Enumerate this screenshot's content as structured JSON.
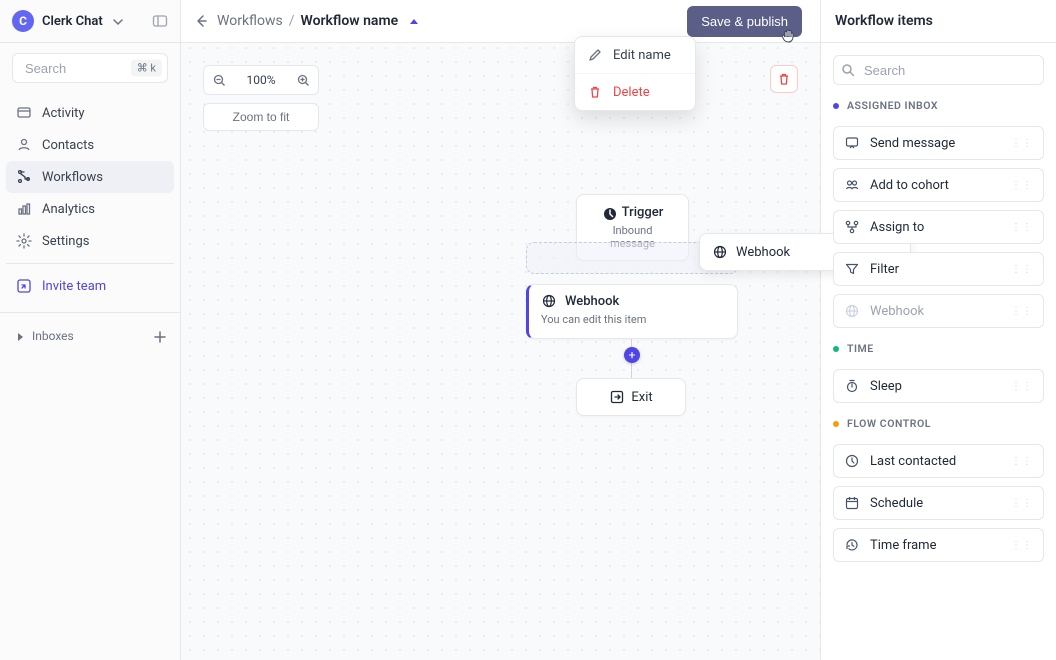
{
  "brand": {
    "name": "Clerk Chat",
    "logo_letter": "C"
  },
  "sidebar": {
    "search_placeholder": "Search",
    "search_kbd": "⌘ k",
    "nav": [
      {
        "label": "Activity"
      },
      {
        "label": "Contacts"
      },
      {
        "label": "Workflows"
      },
      {
        "label": "Analytics"
      },
      {
        "label": "Settings"
      }
    ],
    "invite_label": "Invite team",
    "inboxes_label": "Inboxes"
  },
  "topbar": {
    "crumb_root": "Workflows",
    "slash": "/",
    "crumb_current": "Workflow name",
    "save_label": "Save & publish"
  },
  "popover": {
    "edit_label": "Edit name",
    "delete_label": "Delete"
  },
  "canvas": {
    "zoom_value": "100%",
    "zoom_fit_label": "Zoom to fit",
    "nodes": {
      "trigger": {
        "title": "Trigger",
        "subtitle": "Inbound message"
      },
      "webhook_drag": {
        "title": "Webhook"
      },
      "webhook_sel": {
        "title": "Webhook",
        "subtitle": "You can edit this item"
      },
      "exit": {
        "title": "Exit"
      }
    }
  },
  "rightpanel": {
    "title": "Workflow items",
    "search_placeholder": "Search",
    "groups": [
      {
        "title": "ASSIGNED INBOX",
        "dot_color": "#4f46e5",
        "items": [
          {
            "label": "Send message",
            "icon": "send"
          },
          {
            "label": "Add to cohort",
            "icon": "group"
          },
          {
            "label": "Assign to",
            "icon": "branch"
          },
          {
            "label": "Filter",
            "icon": "filter"
          },
          {
            "label": "Webhook",
            "icon": "globe",
            "disabled": true
          }
        ]
      },
      {
        "title": "TIME",
        "dot_color": "#10b981",
        "items": [
          {
            "label": "Sleep",
            "icon": "timer"
          }
        ]
      },
      {
        "title": "FLOW CONTROL",
        "dot_color": "#f59e0b",
        "items": [
          {
            "label": "Last contacted",
            "icon": "clock"
          },
          {
            "label": "Schedule",
            "icon": "calendar"
          },
          {
            "label": "Time frame",
            "icon": "history"
          }
        ]
      }
    ]
  }
}
